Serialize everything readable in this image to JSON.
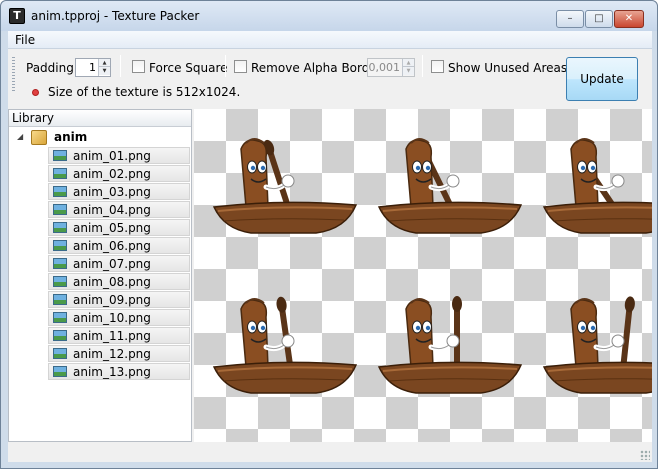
{
  "window": {
    "title": "anim.tpproj - Texture Packer",
    "app_icon_glyph": "T",
    "minimize_glyph": "–",
    "maximize_glyph": "□",
    "close_glyph": "✕"
  },
  "menu": {
    "file_label": "File"
  },
  "toolbar": {
    "padding_label": "Padding:",
    "padding_value": "1",
    "force_square_label": "Force Square",
    "force_square_checked": false,
    "remove_alpha_label": "Remove Alpha Border",
    "remove_alpha_checked": false,
    "alpha_value": "0,001",
    "show_unused_label": "Show Unused Areas",
    "show_unused_checked": false,
    "update_label": "Update",
    "status_text": "Size of the texture is 512x1024.",
    "status_color": "#e04040"
  },
  "library": {
    "header": "Library",
    "root_label": "anim",
    "root_icon": "package-icon",
    "files": [
      "anim_01.png",
      "anim_02.png",
      "anim_03.png",
      "anim_04.png",
      "anim_05.png",
      "anim_06.png",
      "anim_07.png",
      "anim_08.png",
      "anim_09.png",
      "anim_10.png",
      "anim_11.png",
      "anim_12.png",
      "anim_13.png"
    ]
  },
  "canvas": {
    "sprite_description_icon": "rowing-log-character",
    "sprite_count_visible": 6
  }
}
